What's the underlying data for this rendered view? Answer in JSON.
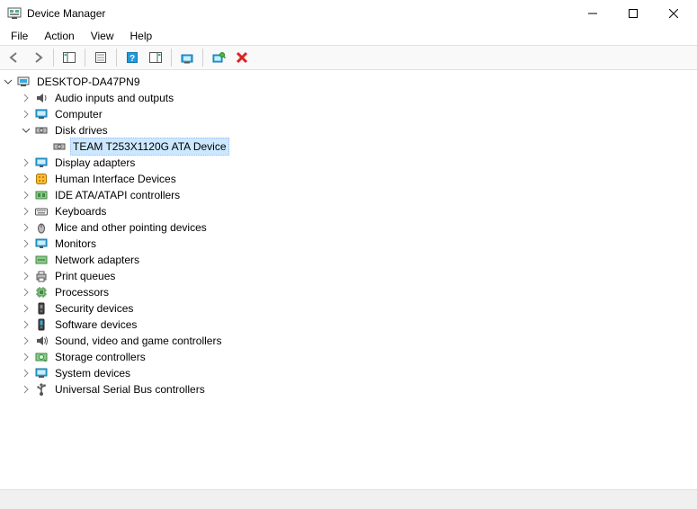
{
  "window": {
    "title": "Device Manager"
  },
  "menu": {
    "file": "File",
    "action": "Action",
    "view": "View",
    "help": "Help"
  },
  "tree": {
    "root": "DESKTOP-DA47PN9",
    "items": [
      {
        "label": "Audio inputs and outputs",
        "icon": "audio",
        "expanded": false
      },
      {
        "label": "Computer",
        "icon": "computer",
        "expanded": false
      },
      {
        "label": "Disk drives",
        "icon": "disk",
        "expanded": true,
        "children": [
          {
            "label": "TEAM T253X1120G ATA Device",
            "icon": "disk",
            "selected": true
          }
        ]
      },
      {
        "label": "Display adapters",
        "icon": "display",
        "expanded": false
      },
      {
        "label": "Human Interface Devices",
        "icon": "hid",
        "expanded": false
      },
      {
        "label": "IDE ATA/ATAPI controllers",
        "icon": "ide",
        "expanded": false
      },
      {
        "label": "Keyboards",
        "icon": "keyboard",
        "expanded": false
      },
      {
        "label": "Mice and other pointing devices",
        "icon": "mouse",
        "expanded": false
      },
      {
        "label": "Monitors",
        "icon": "monitor",
        "expanded": false
      },
      {
        "label": "Network adapters",
        "icon": "network",
        "expanded": false
      },
      {
        "label": "Print queues",
        "icon": "printer",
        "expanded": false
      },
      {
        "label": "Processors",
        "icon": "cpu",
        "expanded": false
      },
      {
        "label": "Security devices",
        "icon": "security",
        "expanded": false
      },
      {
        "label": "Software devices",
        "icon": "software",
        "expanded": false
      },
      {
        "label": "Sound, video and game controllers",
        "icon": "sound",
        "expanded": false
      },
      {
        "label": "Storage controllers",
        "icon": "storage",
        "expanded": false
      },
      {
        "label": "System devices",
        "icon": "system",
        "expanded": false
      },
      {
        "label": "Universal Serial Bus controllers",
        "icon": "usb",
        "expanded": false
      }
    ]
  }
}
